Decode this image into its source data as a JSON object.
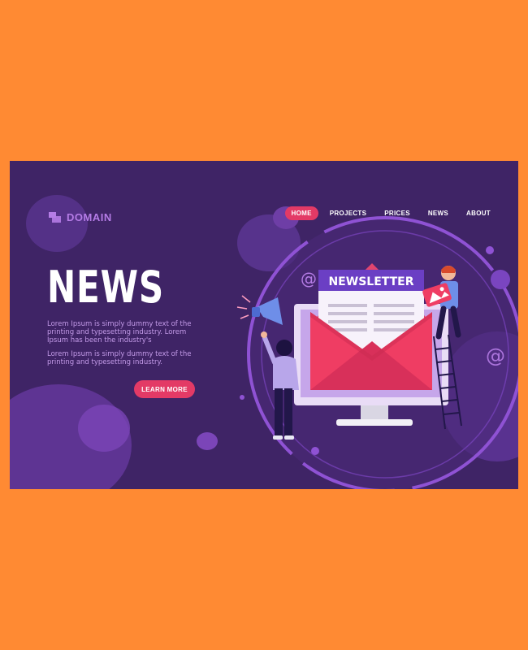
{
  "brand": {
    "name": "DOMAIN"
  },
  "nav": {
    "items": [
      {
        "label": "HOME",
        "active": true
      },
      {
        "label": "PROJECTS",
        "active": false
      },
      {
        "label": "PRICES",
        "active": false
      },
      {
        "label": "NEWS",
        "active": false
      },
      {
        "label": "ABOUT",
        "active": false
      }
    ]
  },
  "hero": {
    "title": "NEWS",
    "paragraph_1": "Lorem Ipsum is simply dummy text of the printing and typesetting industry. Lorem Ipsum has been the industry's",
    "paragraph_2": "Lorem Ipsum is simply dummy text of the printing and typesetting industry.",
    "cta_label": "LEARN MORE"
  },
  "illustration": {
    "banner_text": "NEWSLETTER",
    "at_symbol": "@"
  },
  "colors": {
    "page_bg": "#ff8a33",
    "card_bg": "#3f2466",
    "accent": "#e33a66",
    "purple_light": "#b57ce6"
  },
  "icons": [
    "logo-mark-icon",
    "megaphone-icon",
    "at-sign-icon",
    "image-icon",
    "envelope-icon",
    "monitor-icon",
    "ladder-icon"
  ]
}
